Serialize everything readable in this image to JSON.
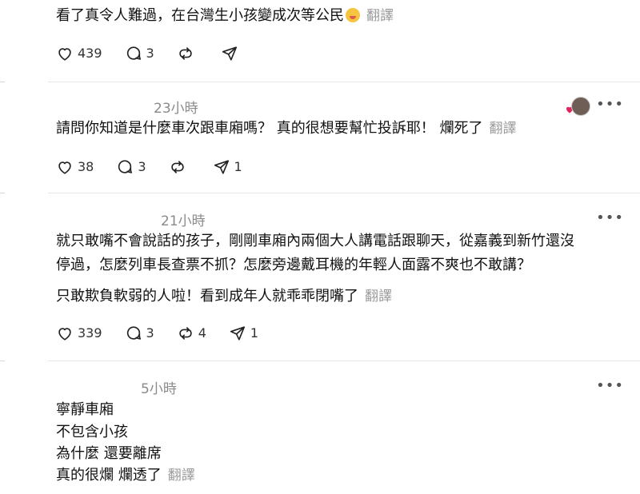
{
  "posts": [
    {
      "lines": [
        "看了真令人難過，在台灣生小孩變成次等公民"
      ],
      "translate": "翻譯",
      "likes": "439",
      "comments": "3",
      "reposts": "",
      "shares": ""
    },
    {
      "time": "23小時",
      "lines": [
        "請問你知道是什麼車次跟車廂嗎？ 真的很想要幫忙投訴耶！ 爛死了"
      ],
      "translate": "翻譯",
      "likes": "38",
      "comments": "3",
      "reposts": "",
      "shares": "1"
    },
    {
      "time": "21小時",
      "lines": [
        "就只敢嘴不會說話的孩子，剛剛車廂內兩個大人講電話跟聊天，從嘉義到新竹還沒",
        "停過，怎麼列車長查票不抓？怎麼旁邊戴耳機的年輕人面露不爽也不敢講？",
        "只敢欺負軟弱的人啦！看到成年人就乖乖閉嘴了"
      ],
      "translate": "翻譯",
      "likes": "339",
      "comments": "3",
      "reposts": "4",
      "shares": "1"
    },
    {
      "time": "5小時",
      "lines": [
        "寧靜車廂",
        "不包含小孩",
        "為什麼 還要離席",
        "真的很爛 爛透了"
      ],
      "translate": "翻譯"
    }
  ],
  "more_label": "•••",
  "icons": {
    "like": "heart-icon",
    "comment": "comment-icon",
    "repost": "repost-icon",
    "share": "send-icon",
    "more": "more-icon"
  },
  "colors": {
    "muted": "#8a8a8a",
    "divider": "#e6e6e6",
    "heart_badge": "#e0245e"
  }
}
